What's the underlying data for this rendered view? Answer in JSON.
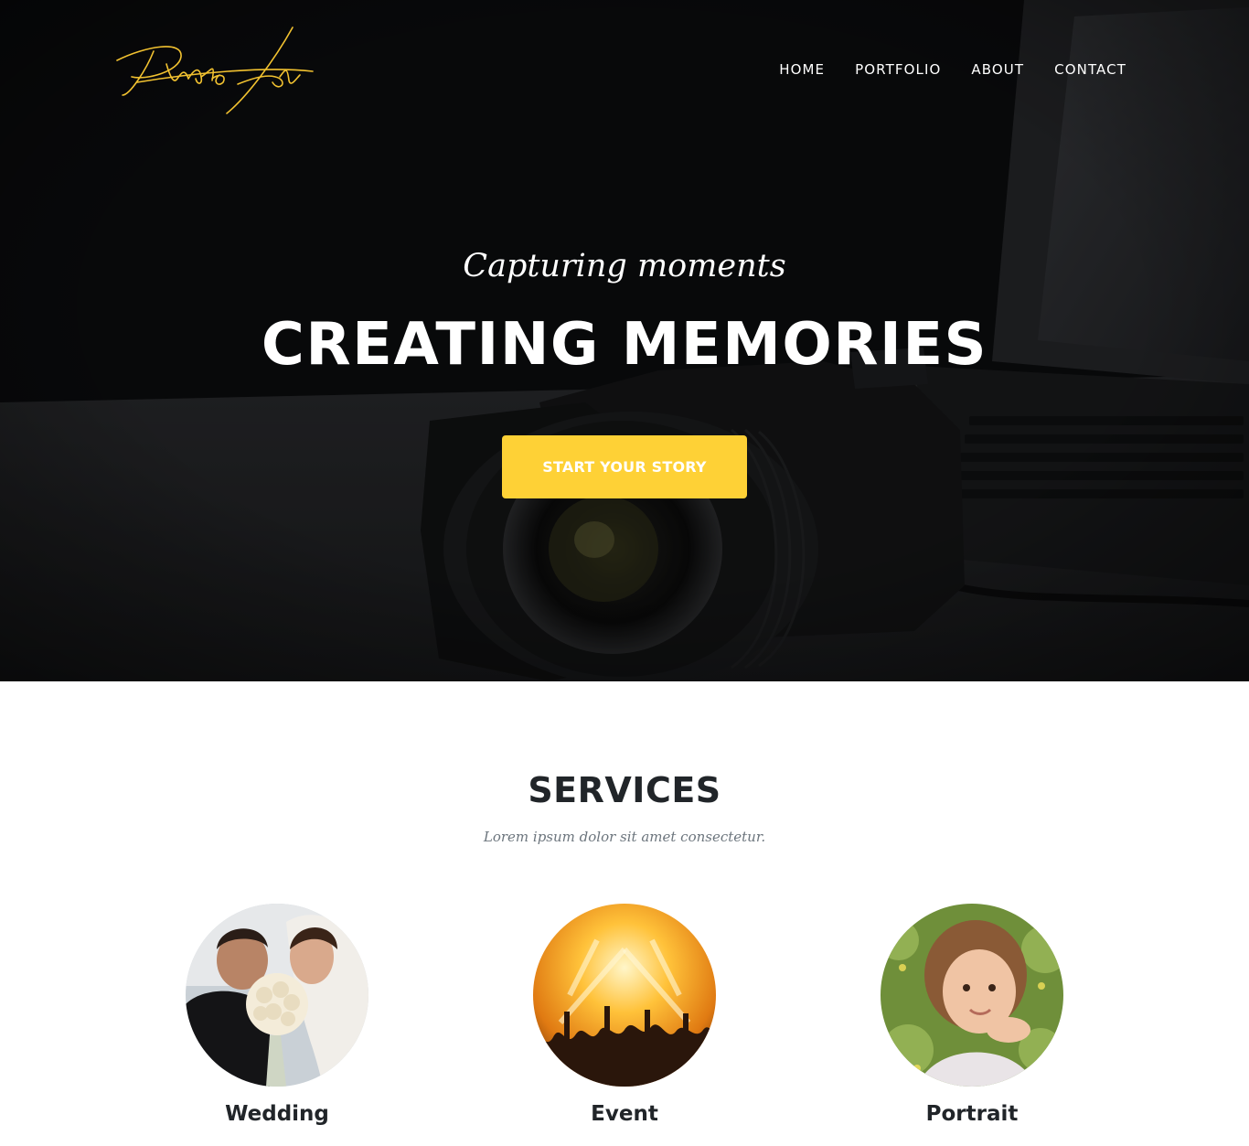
{
  "header": {
    "logo_text": "Photo Art",
    "nav": [
      {
        "label": "HOME"
      },
      {
        "label": "PORTFOLIO"
      },
      {
        "label": "ABOUT"
      },
      {
        "label": "CONTACT"
      }
    ]
  },
  "hero": {
    "tagline": "Capturing moments",
    "heading": "CREATING MEMORIES",
    "cta_label": "START YOUR STORY"
  },
  "services": {
    "title": "SERVICES",
    "subtitle": "Lorem ipsum dolor sit amet consectetur.",
    "items": [
      {
        "label": "Wedding"
      },
      {
        "label": "Event"
      },
      {
        "label": "Portrait"
      }
    ]
  },
  "colors": {
    "accent": "#fed136",
    "logo": "#f2c230",
    "hero_bg": "#0f1012",
    "text_dark": "#212529",
    "text_muted": "#6c757d"
  }
}
